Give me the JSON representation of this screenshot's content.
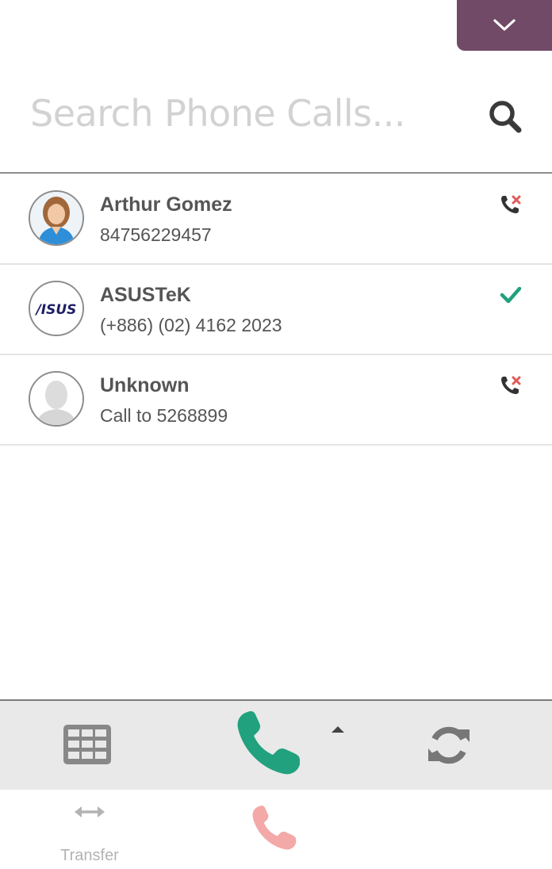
{
  "colors": {
    "accent": "#704a66",
    "call_green": "#21a17e",
    "missed_red": "#e05a5a",
    "done_green": "#21a17e",
    "hangup_pink": "#f2a9a8",
    "icon_gray": "#777777"
  },
  "header": {
    "collapse_icon": "chevron-down-icon"
  },
  "search": {
    "placeholder": "Search Phone Calls...",
    "value": "",
    "icon": "search-icon"
  },
  "calls": [
    {
      "name": "Arthur Gomez",
      "detail": "84756229457",
      "status": "missed",
      "status_icon": "missed-call-icon",
      "avatar": "photo"
    },
    {
      "name": "ASUSTeK",
      "detail": "(+886) (02) 4162 2023",
      "status": "done",
      "status_icon": "check-icon",
      "avatar": "logo",
      "logo_text": "/ISUS"
    },
    {
      "name": "Unknown",
      "detail": "Call to 5268899",
      "status": "missed",
      "status_icon": "missed-call-icon",
      "avatar": "placeholder"
    }
  ],
  "toolbar": {
    "keypad_icon": "keypad-icon",
    "call_icon": "phone-icon",
    "more_icon": "caret-up-icon",
    "refresh_icon": "refresh-icon"
  },
  "actions": {
    "transfer_label": "Transfer",
    "transfer_icon": "transfer-arrows-icon",
    "hangup_icon": "hangup-phone-icon"
  }
}
